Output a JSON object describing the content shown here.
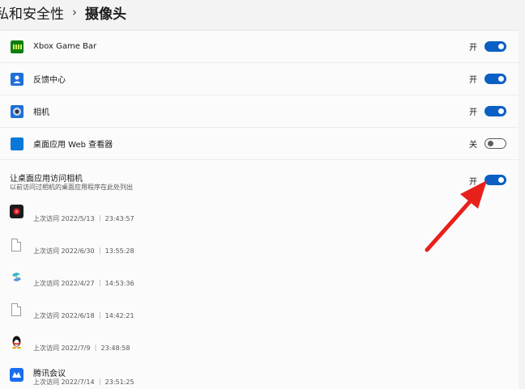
{
  "breadcrumb": {
    "parent": "私和安全性",
    "separator": "›",
    "current": "摄像头"
  },
  "apps": [
    {
      "label": "Xbox Game Bar",
      "state": "开",
      "on": true,
      "color": "#107c10"
    },
    {
      "label": "反馈中心",
      "state": "开",
      "on": true,
      "color": "#1e6fd9"
    },
    {
      "label": "相机",
      "state": "开",
      "on": true,
      "color": "#1e6fd9"
    },
    {
      "label": "桌面应用 Web 查看器",
      "state": "关",
      "on": false,
      "color": "#0a78d7"
    }
  ],
  "desktop_section": {
    "title": "让桌面应用访问相机",
    "description": "以前访问过相机的桌面应用程序在此处列出",
    "state": "开",
    "on": true
  },
  "desktop_apps": [
    {
      "name": "",
      "timestamp": "上次访问 2022/5/13 ｜ 23:43:57",
      "icon": "red-app-icon"
    },
    {
      "name": "",
      "timestamp": "上次访问 2022/6/30 ｜ 13:55:28",
      "icon": "file-icon"
    },
    {
      "name": "",
      "timestamp": "上次访问 2022/4/27 ｜ 14:53:36",
      "icon": "teal-app-icon"
    },
    {
      "name": "",
      "timestamp": "上次访问 2022/6/18 ｜ 14:42:21",
      "icon": "file-icon"
    },
    {
      "name": "",
      "timestamp": "上次访问 2022/7/9 ｜ 23:48:58",
      "icon": "qq-penguin-icon"
    },
    {
      "name": "腾讯会议",
      "timestamp": "上次访问 2022/7/14 ｜ 23:51:25",
      "icon": "tencent-meeting-icon"
    }
  ],
  "colors": {
    "accent": "#0a5fc4",
    "annotation_arrow": "#e8201c"
  }
}
